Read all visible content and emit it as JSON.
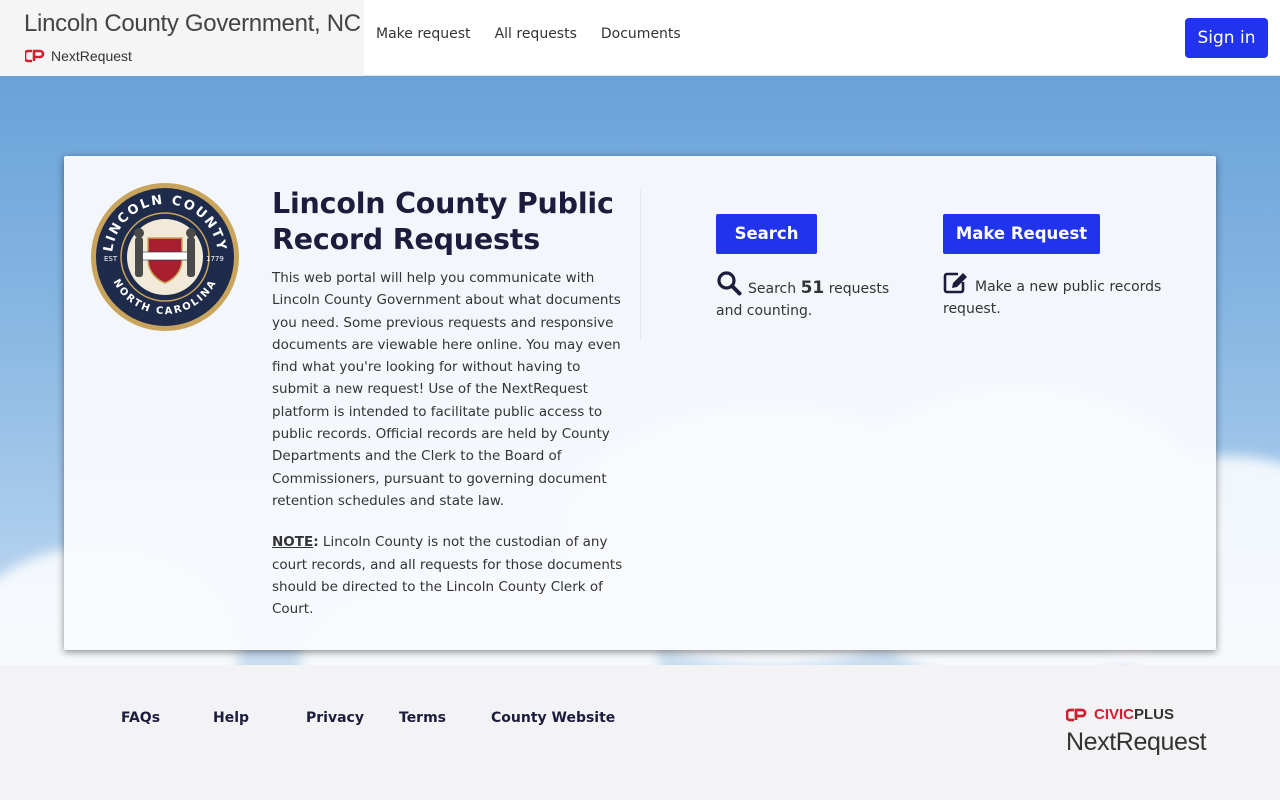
{
  "header": {
    "org_title": "Lincoln County Government, NC",
    "product_name": "NextRequest",
    "nav": [
      {
        "label": "Make request"
      },
      {
        "label": "All requests"
      },
      {
        "label": "Documents"
      }
    ],
    "sign_in_label": "Sign in"
  },
  "hero": {
    "title": "Lincoln County Public Record Requests",
    "intro": "This web portal will help you communicate with Lincoln County Government about what documents you need. Some previous requests and responsive documents are viewable here online. You may even find what you're looking for without having to submit a new request! Use of the NextRequest platform is intended to facilitate public access to public records. Official records are held by County Departments and the Clerk to the Board of Commissioners, pursuant to governing document retention schedules and state law.",
    "note_label": "NOTE",
    "note_colon": ":",
    "note_text": " Lincoln County is not the custodian of any court records, and all requests for those documents should be directed to the Lincoln County Clerk of Court.",
    "seal": {
      "top_text": "LINCOLN COUNTY",
      "bottom_text": "NORTH CAROLINA",
      "est_left": "EST",
      "est_right": "1779",
      "colors": {
        "ring": "#c9a45c",
        "field": "#1e2b4a",
        "shield": "#a82030"
      }
    },
    "search": {
      "button_label": "Search",
      "desc_prefix": "Search",
      "count": "51",
      "desc_suffix": "requests and counting.",
      "icon": "search-icon"
    },
    "make_request": {
      "button_label": "Make Request",
      "desc": "Make a new public records request.",
      "icon": "edit-icon"
    }
  },
  "footer": {
    "links": [
      {
        "label": "FAQs"
      },
      {
        "label": "Help"
      },
      {
        "label": "Privacy"
      },
      {
        "label": "Terms"
      },
      {
        "label": "County Website"
      }
    ],
    "brand_civic": "CIVIC",
    "brand_plus": "PLUS",
    "brand_product": "NextRequest"
  },
  "colors": {
    "accent": "#2233ee",
    "heading": "#1c1c3c",
    "civicplus_red": "#d02030",
    "sky_top": "#6aa2d8"
  }
}
